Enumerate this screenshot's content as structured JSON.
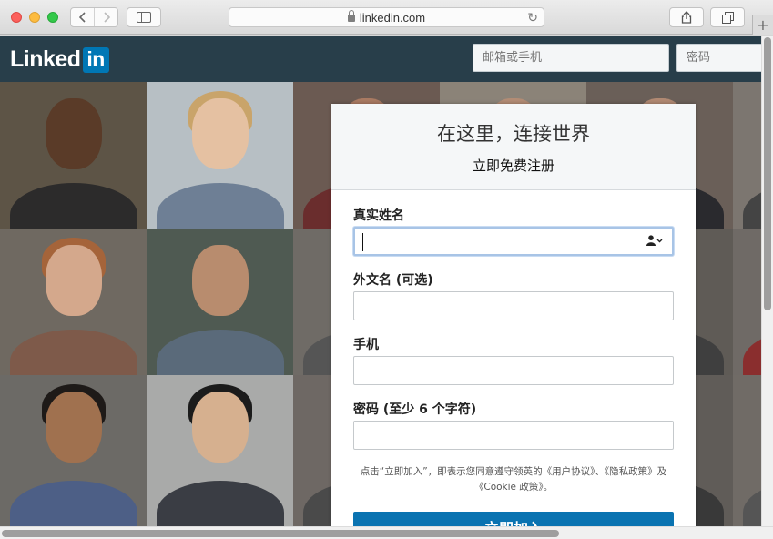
{
  "browser": {
    "url": "linkedin.com"
  },
  "header": {
    "logo_text": "Linked",
    "logo_box": "in",
    "email_placeholder": "邮箱或手机",
    "password_placeholder": "密码"
  },
  "signup": {
    "title": "在这里，连接世界",
    "subtitle": "立即免费注册",
    "fields": [
      {
        "label": "真实姓名",
        "value": ""
      },
      {
        "label": "外文名 (可选)",
        "value": ""
      },
      {
        "label": "手机",
        "value": ""
      },
      {
        "label": "密码 (至少 6 个字符)",
        "value": ""
      }
    ],
    "terms": "点击“立即加入”，即表示您同意遵守领英的《用户协议》、《隐私政策》及《Cookie 政策》。",
    "join_label": "立即加入"
  },
  "colors": {
    "brand": "#0077b5",
    "header_bg": "#283e4a",
    "join_button": "#0a73b1"
  }
}
